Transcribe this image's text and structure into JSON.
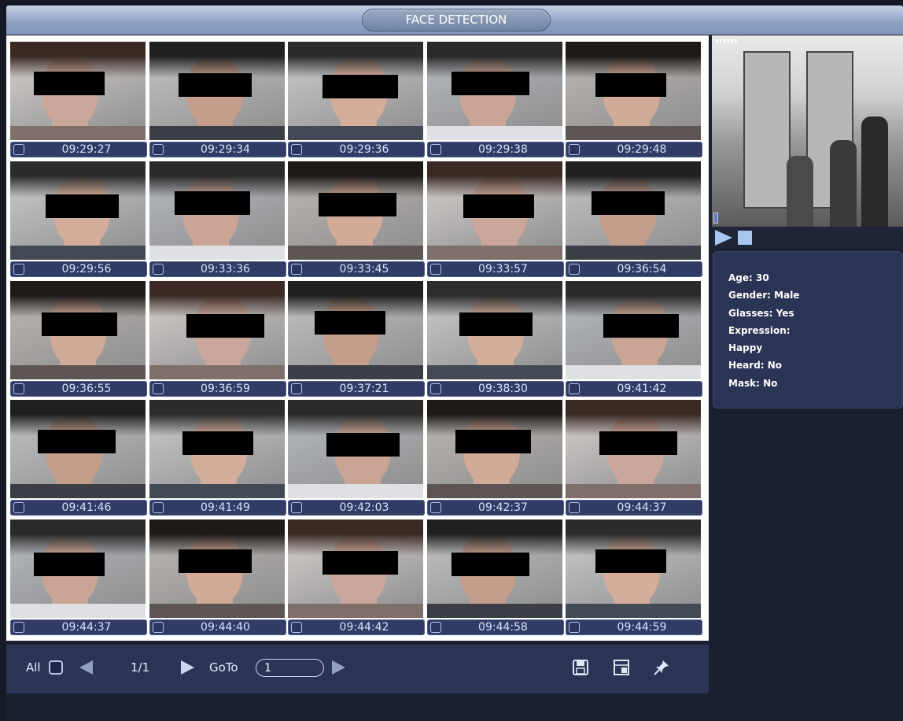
{
  "title": "FACE DETECTION",
  "faces": [
    {
      "time": "09:29:27",
      "selected": false
    },
    {
      "time": "09:29:34",
      "selected": false
    },
    {
      "time": "09:29:36",
      "selected": false
    },
    {
      "time": "09:29:38",
      "selected": false
    },
    {
      "time": "09:29:48",
      "selected": false
    },
    {
      "time": "09:29:56",
      "selected": false
    },
    {
      "time": "09:33:36",
      "selected": false
    },
    {
      "time": "09:33:45",
      "selected": false
    },
    {
      "time": "09:33:57",
      "selected": false
    },
    {
      "time": "09:36:54",
      "selected": false
    },
    {
      "time": "09:36:55",
      "selected": false
    },
    {
      "time": "09:36:59",
      "selected": false
    },
    {
      "time": "09:37:21",
      "selected": true
    },
    {
      "time": "09:38:30",
      "selected": false
    },
    {
      "time": "09:41:42",
      "selected": false
    },
    {
      "time": "09:41:46",
      "selected": false
    },
    {
      "time": "09:41:49",
      "selected": false
    },
    {
      "time": "09:42:03",
      "selected": false
    },
    {
      "time": "09:42:37",
      "selected": false
    },
    {
      "time": "09:44:37",
      "selected": false
    },
    {
      "time": "09:44:37",
      "selected": false
    },
    {
      "time": "09:44:40",
      "selected": false
    },
    {
      "time": "09:44:42",
      "selected": false
    },
    {
      "time": "09:44:58",
      "selected": false
    },
    {
      "time": "09:44:59",
      "selected": false
    }
  ],
  "attributes": {
    "age": "Age: 30",
    "gender": "Gender: Male",
    "glasses": "Glasses: Yes",
    "expression_label": "Expression:",
    "expression_value": "Happy",
    "beard": "Heard: No",
    "mask": "Mask: No"
  },
  "controls": {
    "all_label": "All",
    "page": "1/1",
    "goto_label": "GoTo",
    "goto_value": "1"
  },
  "icons": {
    "play": "play-icon",
    "stop": "stop-icon",
    "prev": "prev-page-icon",
    "next": "next-page-icon",
    "go": "go-icon",
    "save": "save-icon",
    "export": "export-icon",
    "pin": "pin-icon"
  },
  "colors": {
    "accent": "#303b66",
    "selection": "#3ee13a",
    "panel": "#2b3454"
  }
}
